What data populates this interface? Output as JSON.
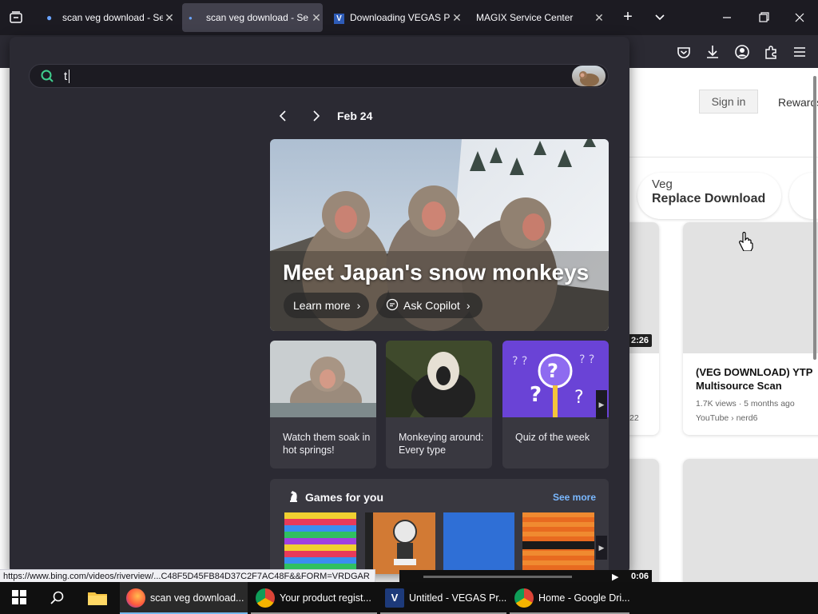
{
  "browser": {
    "tabs": [
      {
        "title": "scan veg download - Se",
        "active": false
      },
      {
        "title": "scan veg download - Se",
        "active": true
      },
      {
        "title": "Downloading VEGAS Pr",
        "active": false
      },
      {
        "title": "MAGIX Service Center",
        "active": false
      }
    ],
    "new_tab_symbol": "+",
    "tab_list_symbol": "⌄"
  },
  "background_page": {
    "sign_in_label": "Sign in",
    "rewards_label": "Rewards",
    "suggestion_pill": {
      "line1": "Veg",
      "line2": "Replace Download"
    },
    "video_card_1": {
      "duration": "2:26",
      "date_fragment": "22"
    },
    "video_card_2": {
      "title": "(VEG DOWNLOAD) YTP Multisource Scan",
      "meta_views": "1.7K views · 5 months ago",
      "meta_source": "YouTube › nerd6"
    }
  },
  "new_tab_panel": {
    "search": {
      "typed_text": "t"
    },
    "date_label": "Feb 24",
    "hero": {
      "title": "Meet Japan's snow monkeys",
      "learn_more_label": "Learn more",
      "ask_copilot_label": "Ask Copilot"
    },
    "cards": [
      {
        "text": "Watch them soak in hot springs!"
      },
      {
        "text": "Monkeying around: Every type"
      },
      {
        "text": "Quiz of the week"
      }
    ],
    "games": {
      "title": "Games for you",
      "see_more_label": "See more"
    }
  },
  "status_bar": {
    "url": "https://www.bing.com/videos/riverview/...C48F5D45FB84D37C2F7AC48F&&FORM=VRDGAR"
  },
  "video_player": {
    "time": "0:06"
  },
  "taskbar": {
    "items": [
      {
        "label": "scan veg download...",
        "active": true
      },
      {
        "label": "Your product regist...",
        "active": false
      },
      {
        "label": "Untitled - VEGAS Pr...",
        "active": false
      },
      {
        "label": "Home - Google Dri...",
        "active": false
      }
    ]
  },
  "colors": {
    "panel_bg": "#2b2a33",
    "tabbar_bg": "#1c1b22",
    "accent_link": "#7ab8ff",
    "taskbar_bg": "#101010"
  }
}
